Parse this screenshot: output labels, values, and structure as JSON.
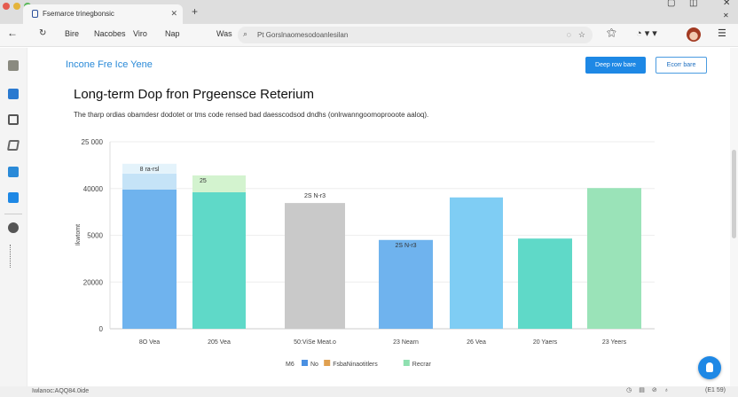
{
  "browser": {
    "tab_title": "Fsemarce trinegbonsic",
    "new_tab": "+",
    "nav_links": [
      "Bire",
      "Nacobes",
      "Viro",
      "Nap",
      "Was"
    ],
    "address": "Pt Gorslnaomesodoanlesilan",
    "status_left": "Iwlanoc:AQQ84.0ide",
    "status_right": "(E1 59)"
  },
  "header": {
    "title": "Incone Fre Ice Yene",
    "primary_button": "Deep row bare",
    "secondary_button": "Ecorr bare"
  },
  "colors": {
    "accent": "#1e88e5",
    "blue": "#6fb3ee",
    "teal": "#5fd9c8",
    "gray": "#c9c9c9",
    "lightblue": "#7fcdf4",
    "green": "#9ae3b8"
  },
  "chart_data": {
    "type": "bar",
    "title": "Long-term Dop fron Prgeensce Reterium",
    "subtitle": "The tharp ordias obamdesr dodotet or tms code rensed bad daesscodsod dndhs (onlrwanngoomoprooote aaloq).",
    "ylabel": "Ikwtomt",
    "yticks": [
      "0",
      "20000",
      "5000",
      "40000",
      "25 000"
    ],
    "ylim": [
      0,
      40000
    ],
    "grid": true,
    "categories": [
      "8O Vea",
      "205 Vea",
      "50:ViSe Meat.o",
      "23 Nearn",
      "26 Vea",
      "20 Yaers",
      "23 Yeers"
    ],
    "series": [
      {
        "values": [
          29800,
          29200,
          26900,
          19000,
          28100,
          19300,
          30100
        ],
        "colors": [
          "#6fb3ee",
          "#5fd9c8",
          "#c9c9c9",
          "#6fb3ee",
          "#7fcdf4",
          "#5fd9c8",
          "#9ae3b8"
        ]
      },
      {
        "values": [
          3400,
          3600,
          0,
          0,
          0,
          0,
          0
        ],
        "colors": [
          "#c5e3f7",
          "#d3f3cf",
          "",
          "",
          "",
          "",
          ""
        ]
      },
      {
        "values": [
          2100,
          0,
          0,
          0,
          0,
          0,
          0
        ],
        "colors": [
          "#e4f3fb",
          "",
          "",
          "",
          "",
          "",
          ""
        ]
      }
    ],
    "data_labels": [
      "8 ra-rsl",
      "25",
      "2S N-r3",
      "2S N-r3",
      "",
      "",
      ""
    ],
    "legend": {
      "placement": "bottom",
      "prefix": "M6",
      "entries": [
        {
          "name": "No",
          "color": "#4a90e2"
        },
        {
          "name": "FsbaNinaotitlers",
          "color": "#e0a050"
        },
        {
          "name": "Recrar",
          "color": "#8fe0b0"
        }
      ]
    }
  }
}
